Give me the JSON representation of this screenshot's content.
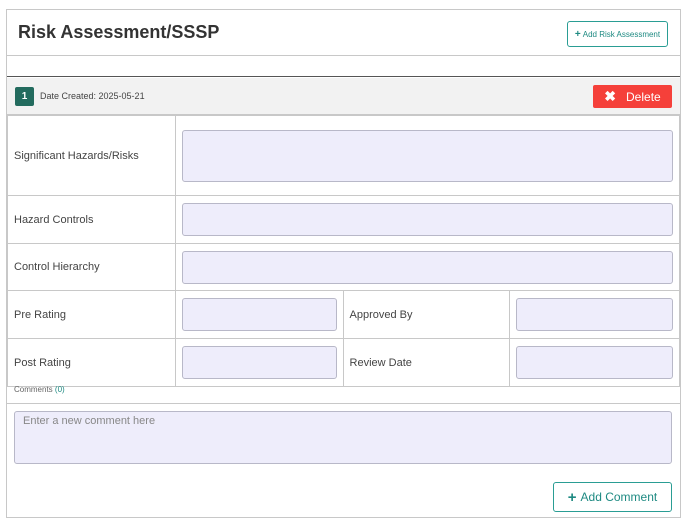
{
  "header": {
    "title": "Risk Assessment/SSSP",
    "add_button_label": "Add Risk Assessment",
    "add_icon": "+"
  },
  "assessment": {
    "number": "1",
    "date_created": "Date Created: 2025-05-21",
    "delete_label": "Delete",
    "delete_icon": "✖",
    "fields": {
      "hazards_label": "Significant Hazards/Risks",
      "hazards_value": "",
      "controls_label": "Hazard Controls",
      "controls_value": "",
      "hierarchy_label": "Control Hierarchy",
      "hierarchy_value": "",
      "pre_rating_label": "Pre Rating",
      "pre_rating_value": "",
      "approved_by_label": "Approved By",
      "approved_by_value": "",
      "post_rating_label": "Post Rating",
      "post_rating_value": "",
      "review_date_label": "Review Date",
      "review_date_value": ""
    }
  },
  "comments": {
    "label": "Comments",
    "count": "(0)",
    "placeholder": "Enter a new comment here",
    "value": "",
    "add_button_label": "Add Comment",
    "add_icon": "+"
  },
  "colors": {
    "accent": "#1e8a82",
    "badge": "#236b5e",
    "danger": "#f5403a",
    "field_bg": "#eeedfb"
  }
}
